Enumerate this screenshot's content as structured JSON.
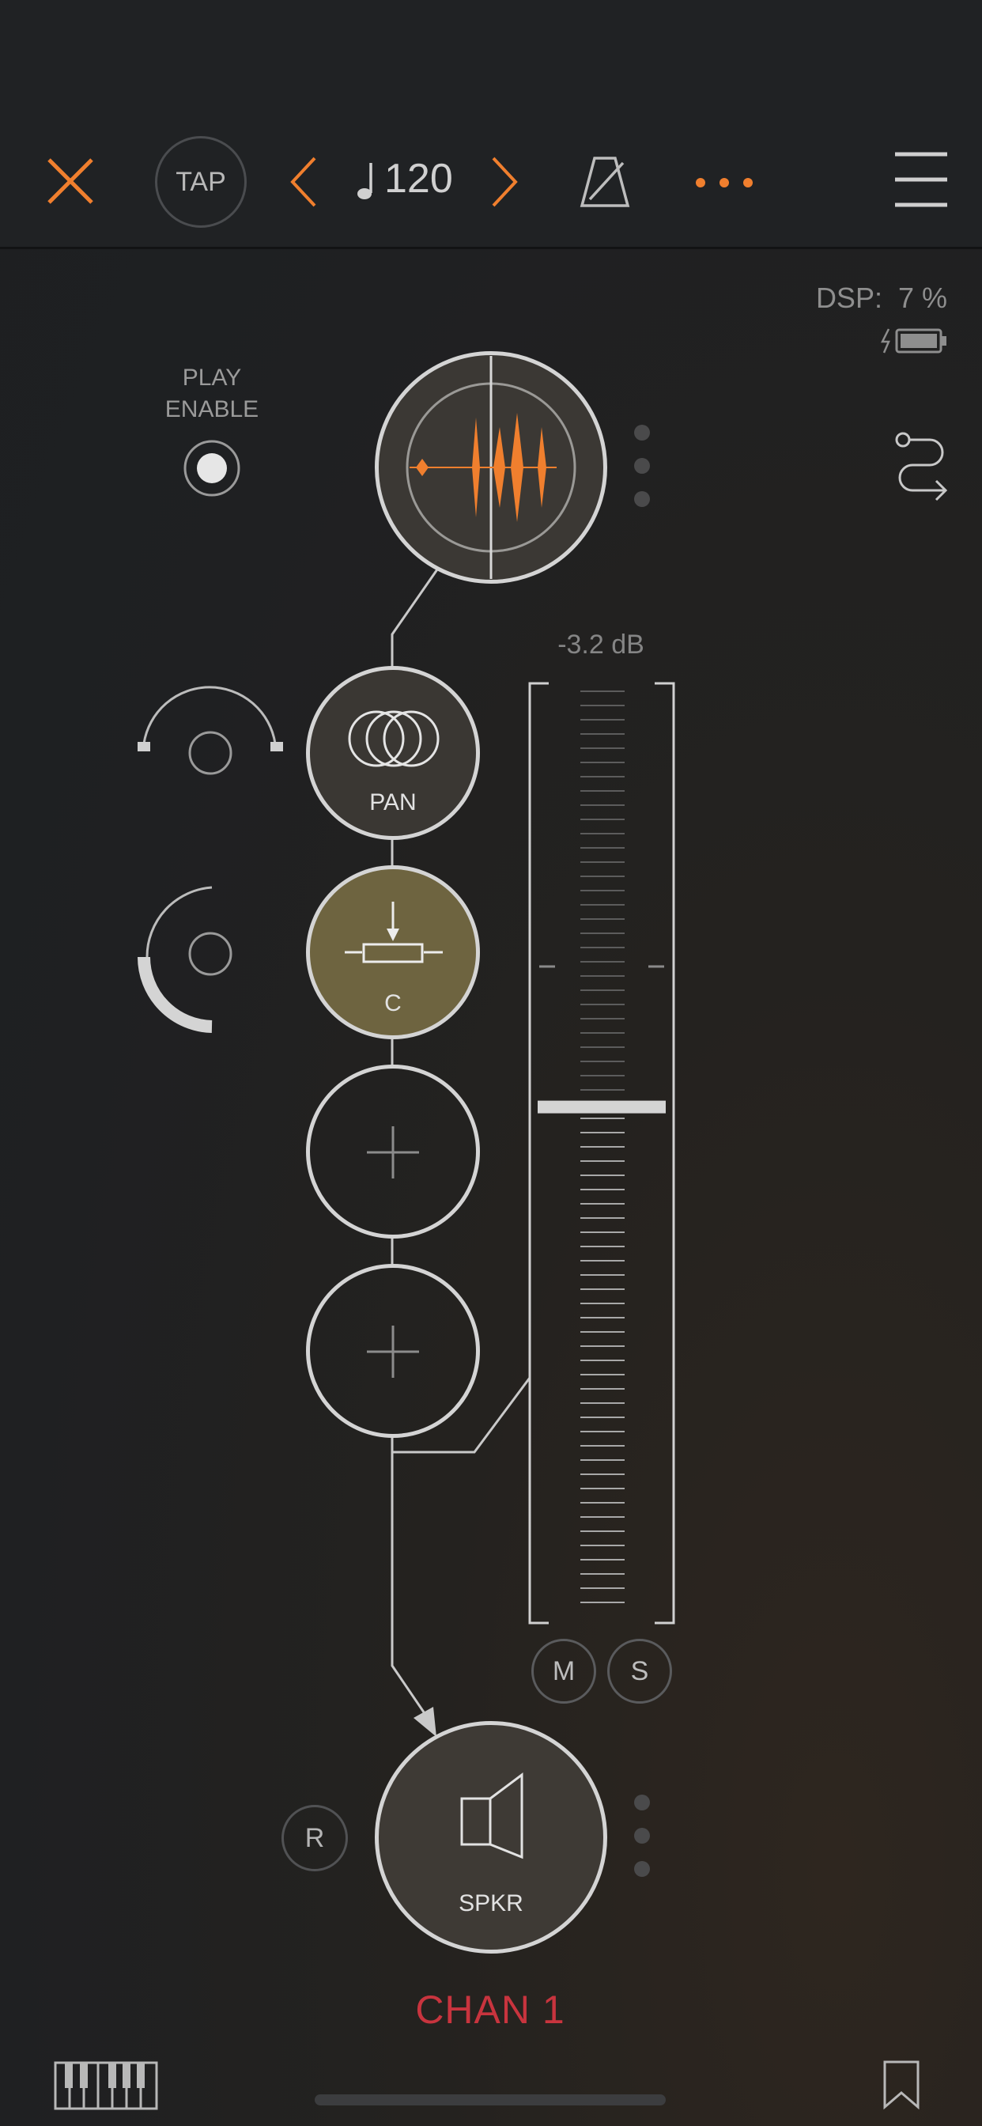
{
  "toolbar": {
    "close_icon": "close-x-icon",
    "tap_label": "TAP",
    "tempo_prev_icon": "chevron-left-icon",
    "tempo_icon": "quarter-note-icon",
    "tempo_value": "120",
    "tempo_next_icon": "chevron-right-icon",
    "metronome_icon": "metronome-icon",
    "more_icon": "ellipsis-icon",
    "menu_icon": "hamburger-menu-icon"
  },
  "status": {
    "dsp_text": "DSP:  7 %",
    "battery_icon": "battery-charging-icon"
  },
  "play_enable": {
    "line1": "PLAY",
    "line2": "ENABLE"
  },
  "routing_icon": "routing-icon",
  "chain": {
    "source_icon": "audio-waveform-icon",
    "pan_label": "PAN",
    "pan_icon": "pan-circles-icon",
    "c_label": "C",
    "c_icon": "resistor-icon",
    "empty_slot_icon": "plus-icon",
    "output_label": "SPKR",
    "output_icon": "speaker-icon"
  },
  "fader": {
    "db_text": "-3.2 dB",
    "level": 0.55,
    "mute_label": "M",
    "solo_label": "S"
  },
  "record_label": "R",
  "channel_name": "CHAN 1",
  "bottom": {
    "keyboard_icon": "piano-keyboard-icon",
    "bookmark_icon": "bookmark-icon"
  },
  "colors": {
    "accent": "#f07f2e",
    "channel_red": "#c8343e",
    "active_node": "#6e6440",
    "node_fill": "#3a3733"
  }
}
